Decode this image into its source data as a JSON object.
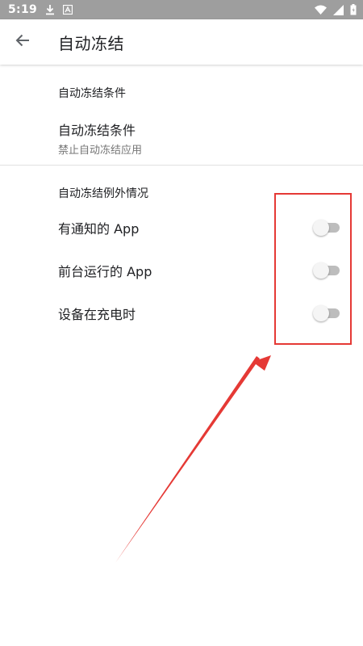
{
  "status_bar": {
    "time": "5:19",
    "left_icons": [
      "download-icon",
      "a-box-icon"
    ],
    "right_icons": [
      "wifi-icon",
      "signal-icon",
      "battery-icon"
    ]
  },
  "app_bar": {
    "title": "自动冻结"
  },
  "sections": {
    "conditions_header": "自动冻结条件",
    "conditions_pref": {
      "title": "自动冻结条件",
      "summary": "禁止自动冻结应用"
    },
    "exceptions_header": "自动冻结例外情况",
    "exceptions": [
      {
        "label": "有通知的 App",
        "enabled": false
      },
      {
        "label": "前台运行的 App",
        "enabled": false
      },
      {
        "label": "设备在充电时",
        "enabled": false
      }
    ]
  },
  "colors": {
    "status_bar": "#9e9e9e",
    "annotation": "#e53935",
    "switch_track_off": "#bdbdbd",
    "switch_thumb_off": "#f5f5f5"
  }
}
